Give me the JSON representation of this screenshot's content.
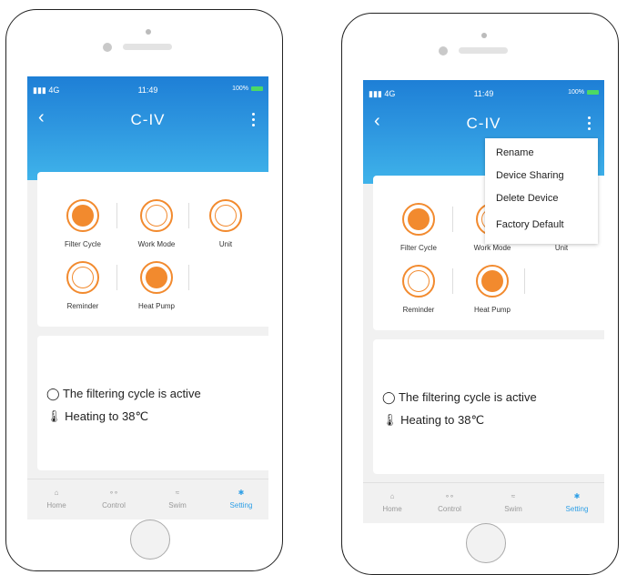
{
  "colors": {
    "accent": "#2e9fe6",
    "icon_orange": "#f28a2e",
    "header": "#1e7fd6"
  },
  "status": {
    "signal": "4G",
    "time": "11:49",
    "battery": "100%"
  },
  "header": {
    "title": "C-IV",
    "back_icon": "chevron-left-icon",
    "more_icon": "more-vertical-icon"
  },
  "features": [
    {
      "label": "Filter Cycle",
      "icon": "filter-cycle-icon"
    },
    {
      "label": "Work Mode",
      "icon": "work-mode-icon"
    },
    {
      "label": "Unit",
      "icon": "thermometer-unit-icon"
    },
    {
      "label": "Reminder",
      "icon": "reminder-icon"
    },
    {
      "label": "Heat Pump",
      "icon": "leaf-icon"
    }
  ],
  "info": {
    "line1": "The filtering cycle is active",
    "line2": "Heating to 38℃"
  },
  "tabs": [
    {
      "label": "Home",
      "icon": "home-icon"
    },
    {
      "label": "Control",
      "icon": "bubbles-icon"
    },
    {
      "label": "Swim",
      "icon": "swimmer-icon"
    },
    {
      "label": "Setting",
      "icon": "gear-icon",
      "active": true
    }
  ],
  "menu": {
    "items": [
      "Rename",
      "Device Sharing",
      "Delete Device",
      "Factory Default"
    ]
  }
}
